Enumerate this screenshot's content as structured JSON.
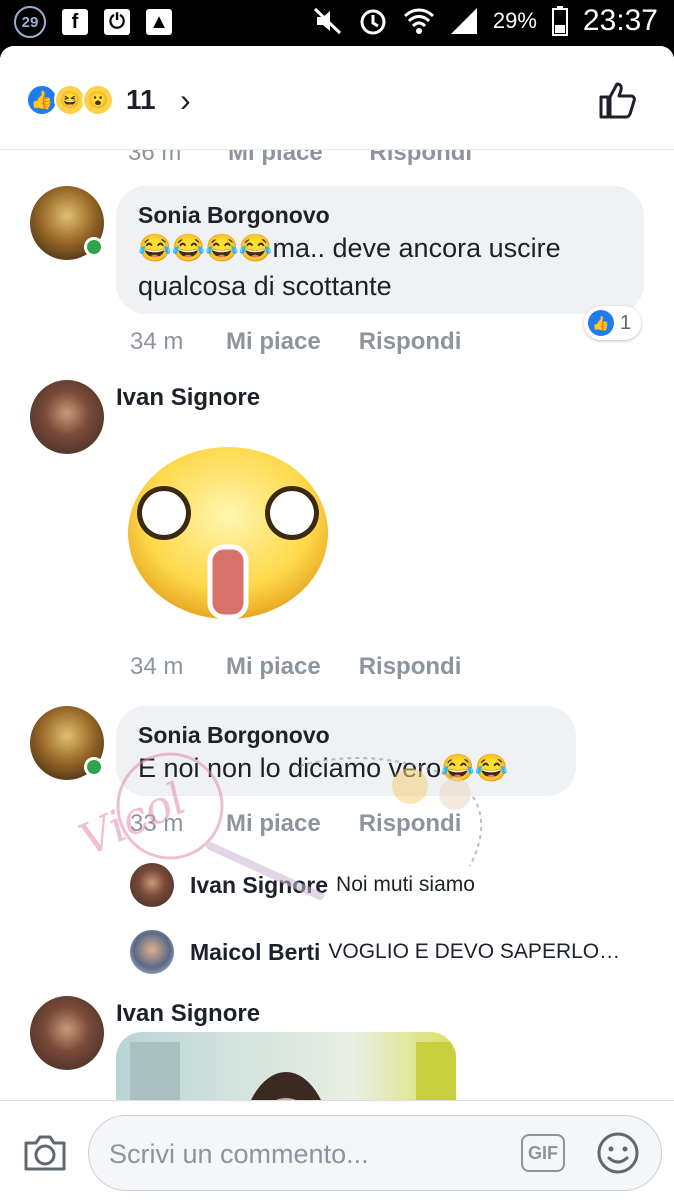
{
  "status_bar": {
    "notif_count": "29",
    "battery": "29%",
    "time": "23:37"
  },
  "reactions": {
    "count": "11",
    "icons": [
      "like-icon",
      "haha-icon",
      "wow-icon"
    ]
  },
  "partial_row": {
    "time": "36 m",
    "like": "Mi piace",
    "reply": "Rispondi"
  },
  "comments": [
    {
      "author": "Sonia Borgonovo",
      "text_line1": "😂😂😂😂ma.. deve ancora uscire",
      "text_line2": "qualcosa di scottante",
      "time": "34 m",
      "like": "Mi piace",
      "reply": "Rispondi",
      "like_count": "1"
    },
    {
      "author": "Ivan Signore",
      "sticker": "shocked-face-sticker",
      "time": "34 m",
      "like": "Mi piace",
      "reply": "Rispondi"
    },
    {
      "author": "Sonia Borgonovo",
      "text_line1": "E noi non lo diciamo vero😂😂",
      "time": "33 m",
      "like": "Mi piace",
      "reply": "Rispondi"
    },
    {
      "author": "Ivan Signore"
    }
  ],
  "replies": [
    {
      "author": "Ivan Signore",
      "text": "Noi muti siamo"
    },
    {
      "author": "Maicol Berti",
      "text": "VOGLIO E DEVO SAPERLO…"
    }
  ],
  "composer": {
    "placeholder": "Scrivi un commento...",
    "gif_label": "GIF"
  },
  "colors": {
    "accent": "#1d7cf2",
    "online": "#31a24c",
    "bubble": "#eff1f3",
    "meta_text": "#8d949e"
  }
}
